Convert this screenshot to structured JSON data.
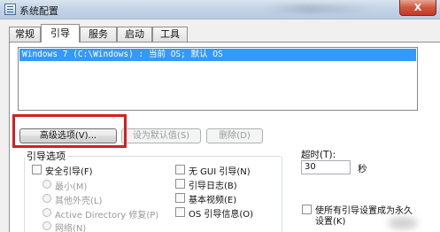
{
  "window": {
    "title": "系统配置",
    "close_label": "X"
  },
  "tabs": [
    {
      "label": "常规"
    },
    {
      "label": "引导"
    },
    {
      "label": "服务"
    },
    {
      "label": "启动"
    },
    {
      "label": "工具"
    }
  ],
  "os_list": {
    "entries": [
      "Windows 7 (C:\\Windows) : 当前 OS; 默认 OS"
    ]
  },
  "buttons": {
    "advanced": "高级选项(V)...",
    "set_default": "设为默认值(S)",
    "delete": "删除(D)"
  },
  "boot_options": {
    "legend": "引导选项",
    "safe_boot": "安全引导(F)",
    "minimal": "最小(M)",
    "alternate_shell": "其他外壳(L)",
    "active_directory": "Active Directory 修复(P)",
    "network": "网络(N)",
    "no_gui_boot": "无 GUI 引导(N)",
    "boot_log": "引导日志(B)",
    "base_video": "基本视频(E)",
    "os_boot_info": "OS 引导信息(O)"
  },
  "timeout": {
    "label": "超时(T):",
    "value": "30",
    "unit": "秒"
  },
  "permanent": {
    "line1": "使所有引导设置成为永久",
    "line2": "设置(K)"
  },
  "colors": {
    "selection": "#3399ff",
    "highlight_box": "#d4201f"
  }
}
